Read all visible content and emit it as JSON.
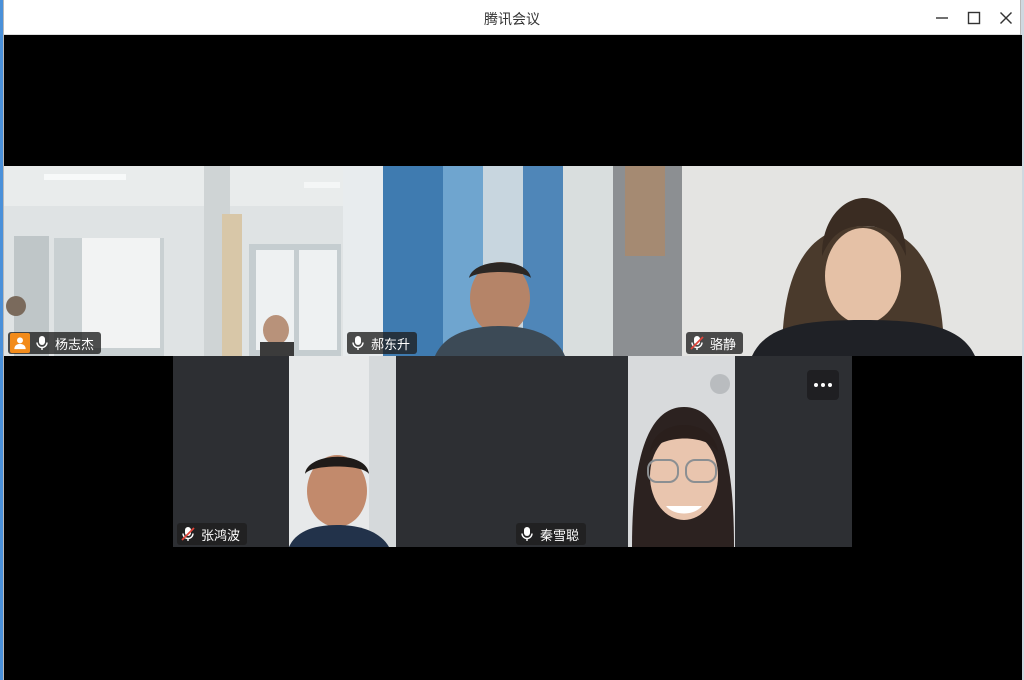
{
  "window": {
    "title": "腾讯会议"
  },
  "participants": [
    {
      "name": "杨志杰",
      "mic": "on",
      "host": true,
      "speaking": true
    },
    {
      "name": "郝东升",
      "mic": "on",
      "host": false,
      "speaking": false
    },
    {
      "name": "骆静",
      "mic": "muted",
      "host": false,
      "speaking": false
    },
    {
      "name": "张鸿波",
      "mic": "muted",
      "host": false,
      "speaking": false
    },
    {
      "name": "秦雪聪",
      "mic": "on",
      "host": false,
      "speaking": false
    }
  ],
  "colors": {
    "speaking_border": "#1db954",
    "host_badge": "#f28b1a",
    "muted_icon": "#e0443a"
  },
  "icons": {
    "minimize": "minimize-icon",
    "maximize": "maximize-icon",
    "close": "close-icon",
    "mic": "mic-icon",
    "mic_muted": "mic-muted-icon",
    "host": "host-icon",
    "more": "more-icon"
  }
}
